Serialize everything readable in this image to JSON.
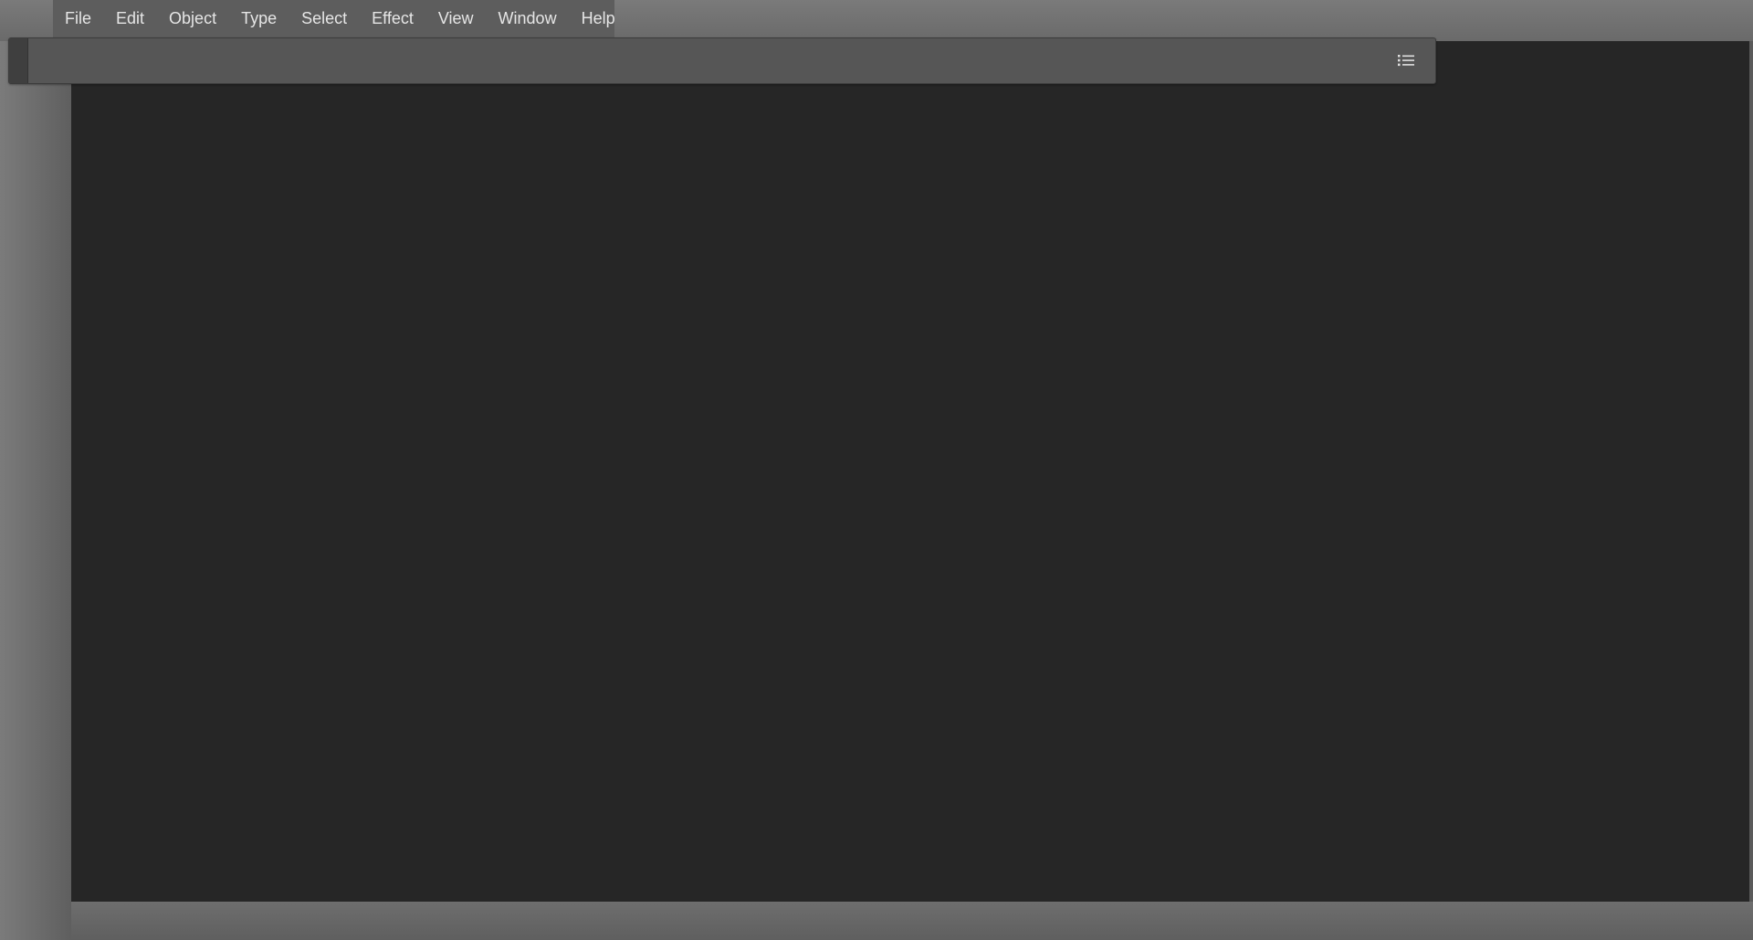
{
  "menubar": {
    "items": [
      {
        "label": "File"
      },
      {
        "label": "Edit"
      },
      {
        "label": "Object"
      },
      {
        "label": "Type"
      },
      {
        "label": "Select"
      },
      {
        "label": "Effect"
      },
      {
        "label": "View"
      },
      {
        "label": "Window"
      },
      {
        "label": "Help"
      }
    ]
  },
  "control_bar": {
    "menu_icon": "panel-menu-icon"
  },
  "colors": {
    "canvas": "#262626",
    "menubar_bg": "#5d5d5d",
    "control_bar_bg": "#565656",
    "menu_text": "#e6e6e6"
  }
}
